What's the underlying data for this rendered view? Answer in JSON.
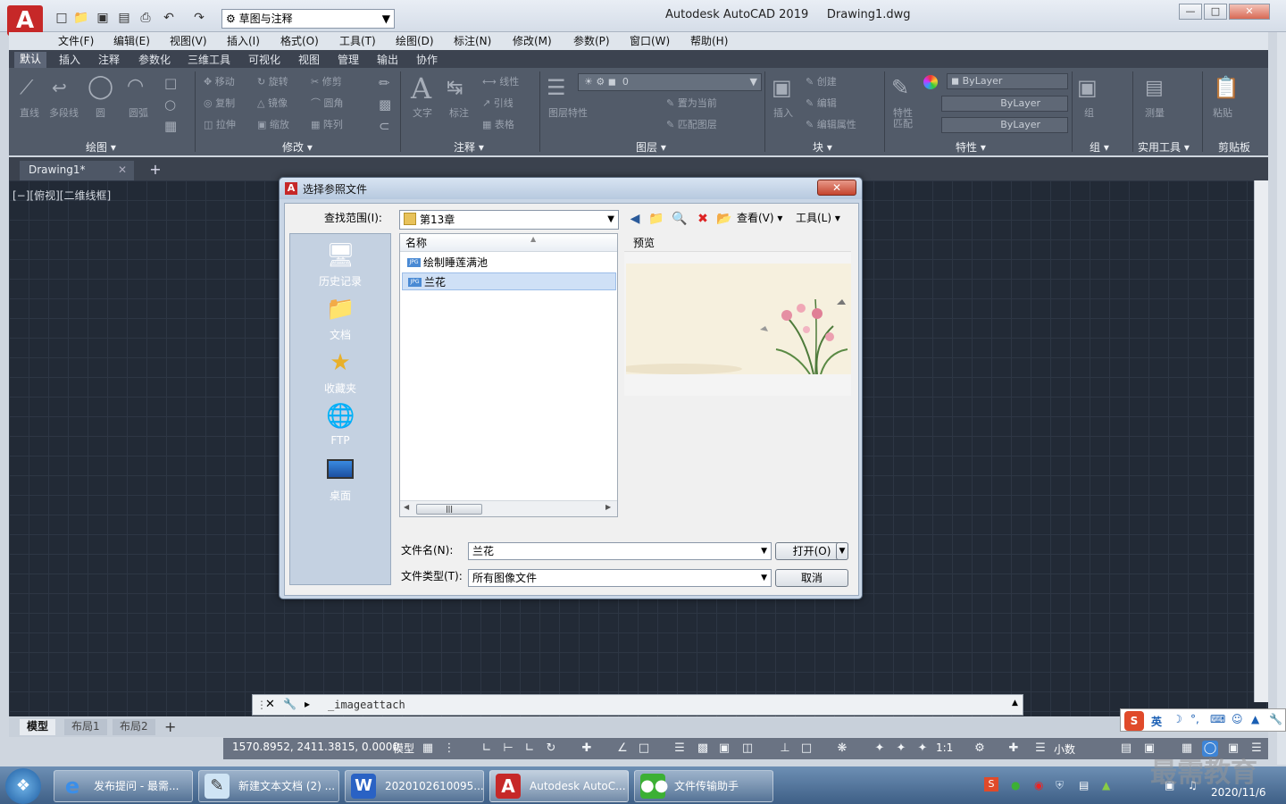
{
  "window": {
    "app_title": "Autodesk AutoCAD 2019",
    "doc_title": "Drawing1.dwg",
    "workspace": "草图与注释"
  },
  "menubar": [
    "文件(F)",
    "编辑(E)",
    "视图(V)",
    "插入(I)",
    "格式(O)",
    "工具(T)",
    "绘图(D)",
    "标注(N)",
    "修改(M)",
    "参数(P)",
    "窗口(W)",
    "帮助(H)"
  ],
  "ribbon_tabs": [
    "默认",
    "插入",
    "注释",
    "参数化",
    "三维工具",
    "可视化",
    "视图",
    "管理",
    "输出",
    "协作"
  ],
  "ribbon": {
    "draw": {
      "title": "绘图",
      "items": [
        "直线",
        "多段线",
        "圆",
        "圆弧"
      ]
    },
    "modify": {
      "title": "修改",
      "items": [
        "移动",
        "旋转",
        "修剪",
        "复制",
        "镜像",
        "圆角",
        "拉伸",
        "缩放",
        "阵列"
      ]
    },
    "annotation": {
      "title": "注释",
      "items": [
        "文字",
        "标注",
        "线性",
        "引线",
        "表格"
      ]
    },
    "layers": {
      "title": "图层",
      "layer_value": "0",
      "items": [
        "图层特性",
        "置为当前",
        "匹配图层"
      ]
    },
    "block": {
      "title": "块",
      "items": [
        "插入",
        "创建",
        "编辑",
        "编辑属性"
      ]
    },
    "properties": {
      "title": "特性",
      "items": [
        "特性匹配"
      ],
      "bylayer1": "ByLayer",
      "bylayer2": "ByLayer",
      "bylayer3": "ByLayer"
    },
    "groups": {
      "title": "组",
      "items": [
        "组"
      ]
    },
    "utilities": {
      "title": "实用工具",
      "items": [
        "测量"
      ]
    },
    "clipboard": {
      "title": "剪贴板",
      "items": [
        "粘贴"
      ]
    }
  },
  "doc_tab": "Drawing1*",
  "viewport_label": "[−][俯视][二维线框]",
  "dialog": {
    "title": "选择参照文件",
    "lookin_label": "查找范围(I):",
    "lookin_value": "第13章",
    "views_label": "查看(V)",
    "tools_label": "工具(L)",
    "places": [
      "历史记录",
      "文档",
      "收藏夹",
      "FTP",
      "桌面"
    ],
    "column_name": "名称",
    "files": [
      "绘制睡莲满池",
      "兰花"
    ],
    "preview_label": "预览",
    "filename_label": "文件名(N):",
    "filename_value": "兰花",
    "filetype_label": "文件类型(T):",
    "filetype_value": "所有图像文件",
    "open_label": "打开(O)",
    "cancel_label": "取消"
  },
  "command_line": "_imageattach",
  "layout_tabs": [
    "模型",
    "布局1",
    "布局2"
  ],
  "status": {
    "coords": "1570.8952, 2411.3815, 0.0000",
    "model": "模型",
    "scale": "1:1",
    "units": "小数"
  },
  "taskbar": {
    "items": [
      "发布提问 - 最需...",
      "新建文本文档 (2) ...",
      "2020102610095...",
      "Autodesk AutoC...",
      "文件传输助手"
    ],
    "clock": "2020/11/6",
    "ime": "英"
  },
  "watermark": "最需教育",
  "colors": {
    "autocad_red": "#c62828",
    "ribbon_bg": "#525b69",
    "canvas_bg": "#222a36"
  }
}
